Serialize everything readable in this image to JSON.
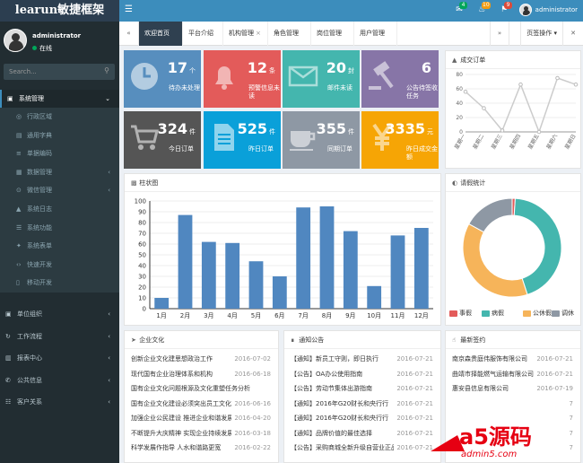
{
  "app": {
    "logo": "learun敏捷框架"
  },
  "topbar": {
    "username": "administrator",
    "badges": [
      {
        "icon": "mail-icon",
        "count": "4",
        "color": "#00a65a"
      },
      {
        "icon": "bell-icon",
        "count": "10",
        "color": "#f39c12"
      },
      {
        "icon": "flag-icon",
        "count": "9",
        "color": "#dd4b39"
      }
    ]
  },
  "sidebar": {
    "user": "administrator",
    "status": "在线",
    "search_placeholder": "Search...",
    "system": "系统管理",
    "sub": [
      {
        "label": "行政区域",
        "icon": "globe"
      },
      {
        "label": "通用字典",
        "icon": "book"
      },
      {
        "label": "单据编码",
        "icon": "barcode"
      },
      {
        "label": "数据管理",
        "icon": "db",
        "arrow": true
      },
      {
        "label": "微信管理",
        "icon": "wechat",
        "arrow": true
      },
      {
        "label": "系统日志",
        "icon": "warn"
      },
      {
        "label": "系统功能",
        "icon": "nav"
      },
      {
        "label": "系统表单",
        "icon": "puzzle"
      },
      {
        "label": "快速开发",
        "icon": "code"
      },
      {
        "label": "移动开发",
        "icon": "mobile"
      }
    ],
    "groups": [
      {
        "label": "单位组织"
      },
      {
        "label": "工作流程"
      },
      {
        "label": "报表中心"
      },
      {
        "label": "公共信息"
      },
      {
        "label": "客户关系"
      }
    ]
  },
  "tabs": {
    "items": [
      "欢迎首页",
      "平台介绍",
      "机构管理",
      "角色管理",
      "岗位管理",
      "用户管理"
    ],
    "page_ops": "页签操作"
  },
  "tiles": [
    {
      "num": "17",
      "unit": "个",
      "label": "待办未处理",
      "color": "#578ebe"
    },
    {
      "num": "12",
      "unit": "条",
      "label": "预警信息未读",
      "color": "#e35b5a"
    },
    {
      "num": "20",
      "unit": "封",
      "label": "邮件未读",
      "color": "#44b6ae"
    },
    {
      "num": "6",
      "unit": "",
      "label": "公告待签收任务",
      "color": "#8775a7"
    },
    {
      "num": "324",
      "unit": "件",
      "label": "今日订单",
      "color": "#555"
    },
    {
      "num": "525",
      "unit": "件",
      "label": "昨日订单",
      "color": "#0aa0d9"
    },
    {
      "num": "355",
      "unit": "件",
      "label": "同期订单",
      "color": "#8e98a4"
    },
    {
      "num": "3335",
      "unit": "元",
      "label": "昨日成交金额",
      "color": "#f6a505"
    }
  ],
  "line_panel": {
    "title": "成交订单"
  },
  "bar_panel": {
    "title": "柱状图"
  },
  "pie_panel": {
    "title": "请假统计"
  },
  "culture": {
    "title": "企业文化",
    "items": [
      {
        "t": "创新企业文化建思想政治工作",
        "d": "2016-07-02"
      },
      {
        "t": "现代国有企业治理体系和机构",
        "d": "2016-06-18"
      },
      {
        "t": "国有企业文化问题根源及文化重塑任务分析",
        "d": ""
      },
      {
        "t": "国有企业文化建设必须突出员工文化",
        "d": "2016-06-16"
      },
      {
        "t": "加强企业公民建设 推进企业和谐发展",
        "d": "2016-04-20"
      },
      {
        "t": "不断提升大庆精神 实现企业持续发展",
        "d": "2016-03-18"
      },
      {
        "t": "科学发展作指导 人水和谐路更宽",
        "d": "2016-02-22"
      }
    ]
  },
  "notice": {
    "title": "通知公告",
    "items": [
      {
        "t": "【通知】新员工守则，即日执行",
        "d": "2016-07-21"
      },
      {
        "t": "【公告】OA办公使用指南",
        "d": "2016-07-21"
      },
      {
        "t": "【公告】劳动节集体出游指南",
        "d": "2016-07-21"
      },
      {
        "t": "【通知】2016年G20财长和央行行",
        "d": "2016-07-21"
      },
      {
        "t": "【通知】2016年G20财长和央行行",
        "d": "2016-07-21"
      },
      {
        "t": "【通知】品牌价值的最佳选择",
        "d": "2016-07-21"
      },
      {
        "t": "【公告】采购商城全新升级自营业正品",
        "d": "2016-07-21"
      }
    ]
  },
  "contracts": {
    "title": "最新签约",
    "items": [
      {
        "t": "南京森贵庭伟服饰有限公司",
        "d": "2016-07-21"
      },
      {
        "t": "曲靖市择能燃气运输有限公司",
        "d": "2016-07-21"
      },
      {
        "t": "惠安县信息有限公司",
        "d": "2016-07-19"
      },
      {
        "t": "",
        "d": "7"
      },
      {
        "t": "",
        "d": "7"
      },
      {
        "t": "",
        "d": "7"
      },
      {
        "t": "",
        "d": "7"
      }
    ]
  },
  "watermark": {
    "brand": "a5源码",
    "url": "admin5.com"
  },
  "chart_data": [
    {
      "type": "bar",
      "title": "柱状图",
      "categories": [
        "1月",
        "2月",
        "3月",
        "4月",
        "5月",
        "6月",
        "7月",
        "8月",
        "9月",
        "10月",
        "11月",
        "12月"
      ],
      "values": [
        10,
        87,
        62,
        61,
        44,
        30,
        94,
        95,
        72,
        21,
        68,
        75
      ],
      "ylim": [
        0,
        100
      ],
      "yticks": [
        0,
        10,
        20,
        30,
        40,
        50,
        60,
        70,
        80,
        90,
        100
      ],
      "color": "#5087c0"
    },
    {
      "type": "line",
      "title": "成交订单",
      "categories": [
        "星期一",
        "星期二",
        "星期三",
        "星期四",
        "星期五",
        "星期六",
        "星期日"
      ],
      "values": [
        56,
        33,
        2,
        66,
        0,
        75,
        66
      ],
      "ylim": [
        0,
        80
      ],
      "yticks": [
        0,
        20,
        40,
        60,
        80
      ]
    },
    {
      "type": "pie",
      "title": "请假统计",
      "series": [
        {
          "name": "事假",
          "value": 1,
          "color": "#e35b5a"
        },
        {
          "name": "病假",
          "value": 44,
          "color": "#44b6ae"
        },
        {
          "name": "公休假",
          "value": 38,
          "color": "#f6b45a"
        },
        {
          "name": "调休",
          "value": 17,
          "color": "#8e98a4"
        }
      ]
    }
  ]
}
